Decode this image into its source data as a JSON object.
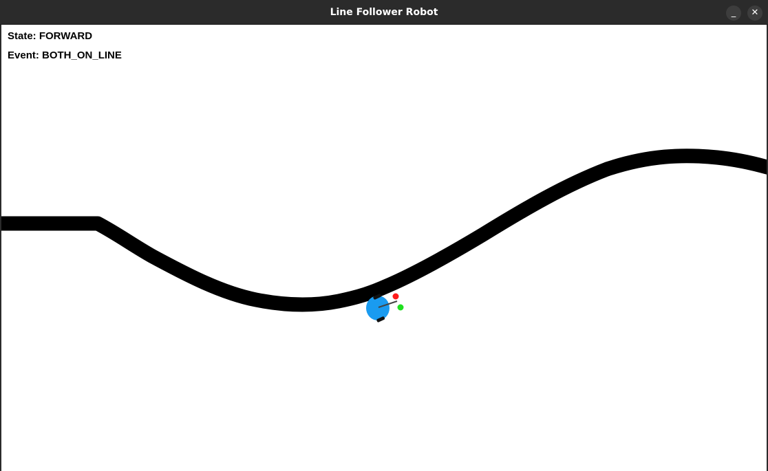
{
  "window": {
    "title": "Line Follower Robot",
    "minimize_glyph": "_",
    "close_glyph": "✕"
  },
  "hud": {
    "state_label": "State: FORWARD",
    "event_label": "Event: BOTH_ON_LINE"
  },
  "colors": {
    "track": "#000000",
    "robot_body": "#1a9bf0",
    "sensor_left": "#ff1a1a",
    "sensor_right": "#1fe01f",
    "canvas_bg": "#ffffff"
  },
  "icons": {
    "minimize": "minimize-icon",
    "close": "close-icon"
  }
}
